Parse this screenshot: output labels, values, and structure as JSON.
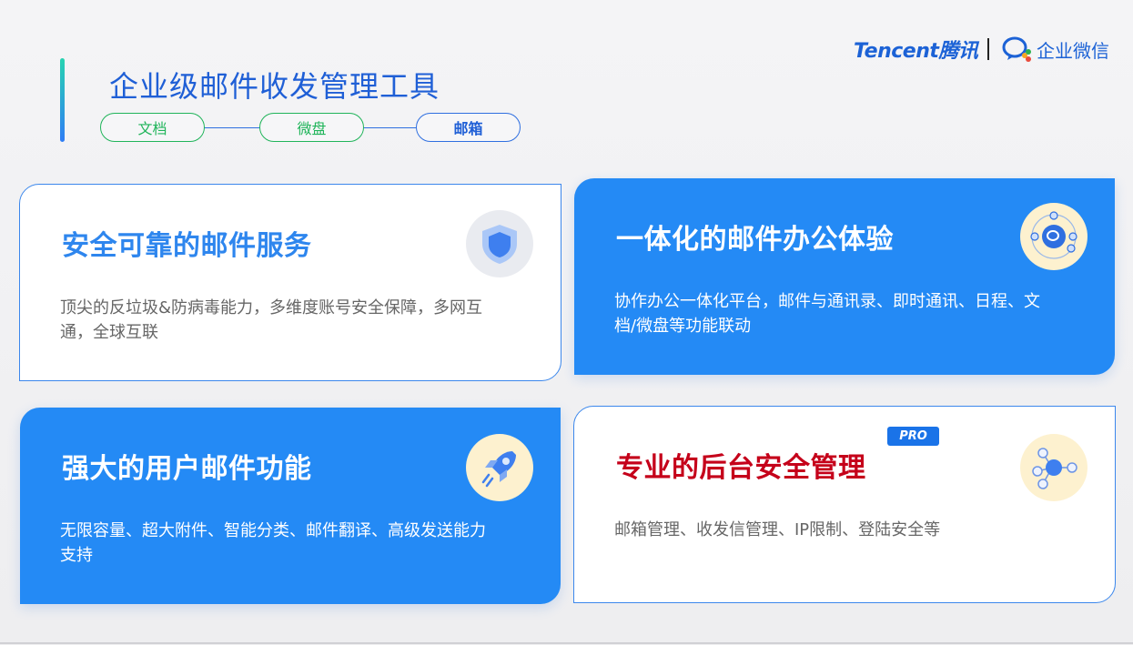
{
  "header": {
    "title": "企业级邮件收发管理工具",
    "steps": [
      {
        "label": "文档",
        "active": false
      },
      {
        "label": "微盘",
        "active": false
      },
      {
        "label": "邮箱",
        "active": true
      }
    ]
  },
  "brand": {
    "tencent": "Tencent腾讯",
    "wework": "企业微信"
  },
  "cards": [
    {
      "title": "安全可靠的邮件服务",
      "desc": "顶尖的反垃圾&防病毒能力，多维度账号安全保障，多网互通，全球互联",
      "icon": "shield-icon",
      "style": "white"
    },
    {
      "title": "一体化的邮件办公体验",
      "desc": "协作办公一体化平台，邮件与通讯录、即时通讯、日程、文档/微盘等功能联动",
      "icon": "integration-network-icon",
      "style": "blue"
    },
    {
      "title": "强大的用户邮件功能",
      "desc": "无限容量、超大附件、智能分类、邮件翻译、高级发送能力支持",
      "icon": "rocket-icon",
      "style": "blue"
    },
    {
      "title": "专业的后台安全管理",
      "desc": "邮箱管理、收发信管理、IP限制、登陆安全等",
      "icon": "admin-network-icon",
      "badge": "PRO",
      "style": "white"
    }
  ],
  "colors": {
    "accent_blue": "#248af5",
    "title_blue": "#1f5fd6",
    "step_green": "#20b45a",
    "pro_title_red": "#c5001a"
  }
}
